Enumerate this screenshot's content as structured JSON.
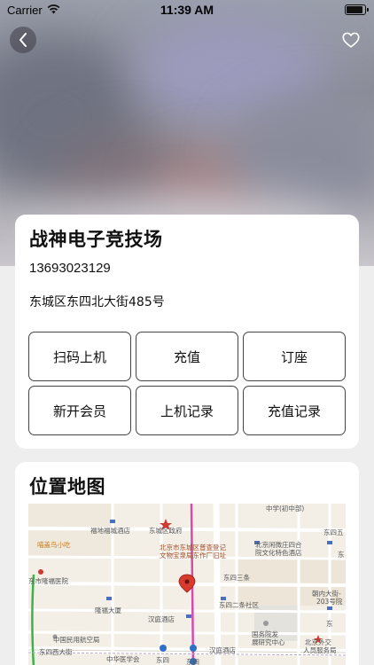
{
  "status_bar": {
    "carrier": "Carrier",
    "time": "11:39 AM"
  },
  "nav": {
    "back_icon": "chevron-left-icon",
    "favorite_icon": "heart-outline-icon"
  },
  "store": {
    "name": "战神电子竞技场",
    "phone": "13693023129",
    "address": "东城区东四北大街485号"
  },
  "actions": [
    {
      "label": "扫码上机"
    },
    {
      "label": "充值"
    },
    {
      "label": "订座"
    },
    {
      "label": "新开会员"
    },
    {
      "label": "上机记录"
    },
    {
      "label": "充值记录"
    }
  ],
  "map": {
    "title": "位置地图",
    "labels": {
      "l1": "中学(初中部)",
      "l2": "福地福城酒店",
      "l3": "东城区政府",
      "l4": "东四五",
      "l5": "北京市东城区普查登记",
      "l6": "文物宝泉局东作厂旧址",
      "l7": "北京闲微庄四合",
      "l8": "院文化特色酒店",
      "l9": "喵盖鸟小吃",
      "l10": "东市隆福医院",
      "l11": "东四三条",
      "l12": "朝内大街-",
      "l13": "203号院",
      "l14": "隆福大厦",
      "l15": "东四二条社区",
      "l16": "汉庭酒店",
      "l17": "国务院发",
      "l18": "展研究中心",
      "l19": "中国民用航空局",
      "l20": "北京外交",
      "l21": "人员服务局",
      "l22": "东四西大街",
      "l23": "中华医学会",
      "l24": "东四",
      "l25": "汉庭酒店",
      "l26": "东四",
      "l27": "东",
      "l28": "东"
    }
  }
}
